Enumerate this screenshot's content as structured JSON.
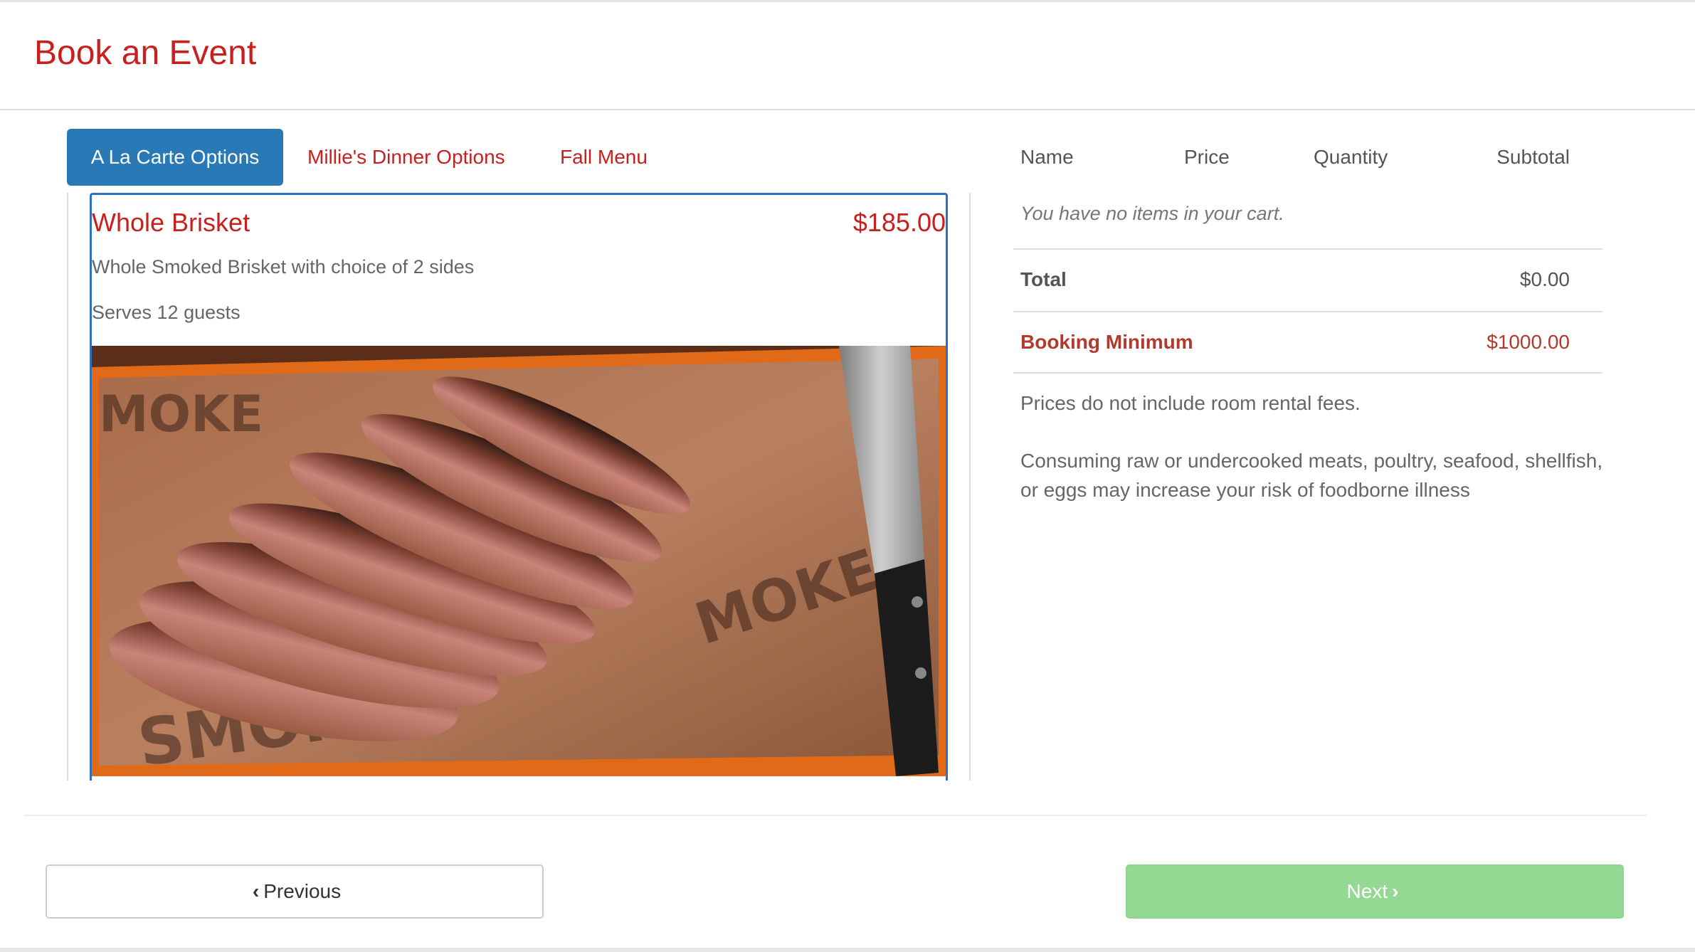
{
  "header": {
    "title": "Book an Event"
  },
  "tabs": [
    {
      "label": "A La Carte Options",
      "active": true
    },
    {
      "label": "Millie's Dinner Options",
      "active": false
    },
    {
      "label": "Fall Menu",
      "active": false
    }
  ],
  "menu_item": {
    "name": "Whole Brisket",
    "price": "$185.00",
    "description": "Whole Smoked Brisket with choice of 2 sides",
    "serves": "Serves 12 guests"
  },
  "cart": {
    "columns": {
      "name": "Name",
      "price": "Price",
      "quantity": "Quantity",
      "subtotal": "Subtotal"
    },
    "empty_message": "You have no items in your cart.",
    "total_label": "Total",
    "total_value": "$0.00",
    "minimum_label": "Booking Minimum",
    "minimum_value": "$1000.00",
    "note_rental": "Prices do not include room rental fees.",
    "note_consumption": "Consuming raw or undercooked meats, poultry, seafood, shellfish, or eggs may increase your risk of foodborne illness"
  },
  "footer": {
    "previous_label": "Previous",
    "next_label": "Next"
  },
  "colors": {
    "brand_red": "#c8201e",
    "active_tab": "#2a79b7",
    "next_button": "#93d893",
    "minimum_text": "#b03a2e"
  },
  "icons": {
    "previous": "chevron-left-icon",
    "next": "chevron-right-icon"
  }
}
